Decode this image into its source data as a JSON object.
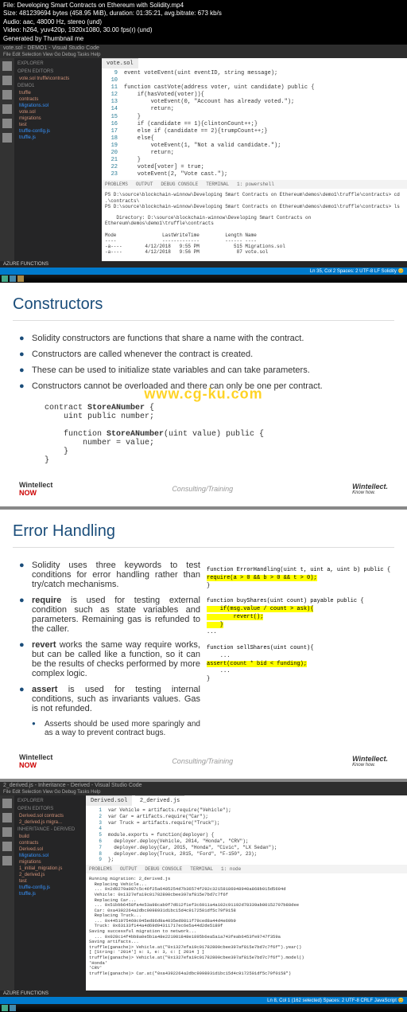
{
  "header": {
    "file": "File: Developing Smart Contracts on Ethereum with Solidity.mp4",
    "size": "Size: 481239694 bytes (458.95 MiB), duration: 01:35:21, avg.bitrate: 673 kb/s",
    "audio": "Audio: aac, 48000 Hz, stereo (und)",
    "video": "Video: h264, yuv420p, 1920x1080, 30.00 fps(r) (und)",
    "gen": "Generated by Thumbnail me"
  },
  "vscode1": {
    "title": "vote.sol - DEMO1 - Visual Studio Code",
    "menu": "File  Edit  Selection  View  Go  Debug  Tasks  Help",
    "explorer": "EXPLORER",
    "open_editors": "OPEN EDITORS",
    "open_file": "vote.sol truffle\\contracts",
    "project": "DEMO1",
    "tree": [
      "truffle",
      "contracts",
      "Migrations.sol",
      "vote.sol",
      "migrations",
      "test",
      "truffle-config.js",
      "truffle.js"
    ],
    "azure": "AZURE FUNCTIONS",
    "tab": "vote.sol",
    "code_lines": [
      {
        "n": "9",
        "t": "event voteEvent(uint eventID, string message);"
      },
      {
        "n": "10",
        "t": ""
      },
      {
        "n": "11",
        "t": "function castVote(address voter, uint candidate) public {"
      },
      {
        "n": "12",
        "t": "    if(hasVoted(voter)){"
      },
      {
        "n": "13",
        "t": "        voteEvent(0, \"Account has already voted.\");"
      },
      {
        "n": "14",
        "t": "        return;"
      },
      {
        "n": "15",
        "t": "    }"
      },
      {
        "n": "16",
        "t": "    if (candidate == 1){clintonCount++;}"
      },
      {
        "n": "17",
        "t": "    else if (candidate == 2){trumpCount++;}"
      },
      {
        "n": "18",
        "t": "    else{"
      },
      {
        "n": "19",
        "t": "        voteEvent(1, \"Not a valid candidate.\");"
      },
      {
        "n": "20",
        "t": "        return;"
      },
      {
        "n": "21",
        "t": "    }"
      },
      {
        "n": "22",
        "t": "    voted[voter] = true;"
      },
      {
        "n": "23",
        "t": "    voteEvent(2, \"Vote cast.\");"
      }
    ],
    "term_tabs": [
      "PROBLEMS",
      "OUTPUT",
      "DEBUG CONSOLE",
      "TERMINAL"
    ],
    "term_select": "1: powershell",
    "term_body": "PS D:\\source\\blockchain-winnow\\Developing Smart Contracts on Ethereum\\demos\\demo1\\truffle\\contracts> cd .\\contracts\\\nPS D:\\source\\blockchain-winnow\\Developing Smart Contracts on Ethereum\\demos\\demo1\\truffle\\contracts> ls\n\n    Directory: D:\\source\\blockchain-winnow\\Developing Smart Contracts on Ethereum\\demos\\demo1\\truffle\\contracts\n\nMode                LastWriteTime         Length Name\n----                -------------         ------ ----\n-a----        4/12/2018   9:55 PM            515 Migrations.sol\n-a----        4/12/2018   9:56 PM             87 vote.sol\n\nPS D:\\source\\blockchain-winnow\\Developing Smart Contracts on Ethereum\\demos\\demo1\\truffle\\contracts>",
    "status_right": "Ln 35, Col 2   Spaces: 2   UTF-8   LF   Solidity   😊"
  },
  "slide1": {
    "title": "Constructors",
    "bullets": [
      "Solidity constructors are functions that share a name with the contract.",
      "Constructors are called whenever the contract is created.",
      "These can be used to initialize state variables and can take parameters.",
      "Constructors cannot be overloaded and there can only be one per contract."
    ],
    "code": "contract StoreANumber {\n    uint public number;\n\n    function StoreANumber(uint value) public {\n        number = value;\n    }\n}",
    "footer_center": "Consulting/Training",
    "watermark": "www.cg-ku.com",
    "logo_now": "Wintellect NOW",
    "logo_win": "Wintellect.",
    "logo_win_sub": "Know how."
  },
  "slide2": {
    "title": "Error Handling",
    "bullets": [
      "Solidity uses three keywords to test conditions for error handling rather than try/catch mechanisms.",
      "require is used for testing external condition such as state variables and parameters. Remaining gas is refunded to the caller.",
      "revert works the same way require works, but can be called like a function, so it can be the results of checks performed by more complex logic.",
      "assert is used for testing internal conditions, such as invariants values. Gas is not refunded."
    ],
    "sub_bullet": "Asserts should be used more sparingly and as a way to prevent contract bugs.",
    "code_r1": "function ErrorHandling(uint t, uint a, uint b) public {",
    "code_r1_hl": "    require(a > 0 && b > 0 && t > 0);",
    "code_r1b": "}",
    "code_r2": "function buyShares(uint count) payable public {",
    "code_r2_hl": "    if(msg.value / count > ask){\n        revert();",
    "code_r2b": "    }\n    ...",
    "code_r3": "function sellShares(uint count){\n    ...",
    "code_r3_hl": "    assert(count * bid < funding);",
    "code_r3b": "    ...\n}",
    "footer_center": "Consulting/Training"
  },
  "vscode2": {
    "title": "2_derived.js - Inheritance - Derived - Visual Studio Code",
    "explorer": "EXPLORER",
    "open_editors": "OPEN EDITORS",
    "open_files": [
      "Derived.sol contracts",
      "2_derived.js migra..."
    ],
    "project": "INHERITANCE - DERIVED",
    "tree": [
      "build",
      "contracts",
      "Derived.sol",
      "Migrations.sol",
      "migrations",
      "1_initial_migration.js",
      "2_derived.js",
      "test",
      "truffle-config.js",
      "truffle.js"
    ],
    "azure": "AZURE FUNCTIONS",
    "tabs": [
      "Derived.sol",
      "2_derived.js"
    ],
    "code_lines": [
      {
        "n": "1",
        "t": "var Vehicle = artifacts.require(\"Vehicle\");"
      },
      {
        "n": "2",
        "t": "var Car = artifacts.require(\"Car\");"
      },
      {
        "n": "3",
        "t": "var Truck = artifacts.require(\"Truck\");"
      },
      {
        "n": "4",
        "t": ""
      },
      {
        "n": "5",
        "t": "module.exports = function(deployer) {"
      },
      {
        "n": "6",
        "t": "  deployer.deploy(Vehicle, 2014, \"Honda\", \"CRV\");"
      },
      {
        "n": "7",
        "t": "  deployer.deploy(Car, 2015, \"Honda\", \"Civic\", \"LX Sedan\");"
      },
      {
        "n": "8",
        "t": "  deployer.deploy(Truck, 2015, \"Ford\", \"F-150\", 23);"
      },
      {
        "n": "9",
        "t": "};"
      }
    ],
    "term_tabs": [
      "PROBLEMS",
      "OUTPUT",
      "DEBUG CONSOLE",
      "TERMINAL"
    ],
    "term_select": "1: node",
    "term_body": "Running migration: 2_derived.js\n  Replacing Vehicle...\n  ... 0x2d8279a087c5c46f25a6485254d7b36574f292c32158186048940a868b015d5694d\n  Vehicle: 0x1327efa19c01782800cbee397af815e7bd7c7f6f\n  Replacing Car...\n  ... 0x51bbb6458fa4e53a98cab9f7d612f1ef3c6911a4a102c91192d78339ab80152707b88dee\n  Car: 0xa4392264a2dbc9098931d1bc15d4c9172501df5c79f0158\n  Replacing Truck...\n  ... 0x4451975469c945ed86d9a4035ed9811f79ced8a44d4e69b9\n  Truck: 0x63133f144a4d69d94311717ec6e5a44d2de5189f\nSaving successful migration to network...\n  ... 0x028c14f4bb8a0e5b1a48e221981848e1895b6ea5a1a743feab6453fe9747f359a\nSaving artifacts...\ntruffle(ganache)> Vehicle.at(\"0x1327efa19c01782800cbee397af815e7bd7c7f6f\").year()\n[ [String: '2014'] s: 1, e: 3, c: [ 2014 ] ]\ntruffle(ganache)> Vehicle.at(\"0x1327efa19c01782800cbee397af815e7bd7c7f6f\").model()\n'Honda'\n'CRV'\ntruffle(ganache)> Car.at(\"0xa4392264a2dbc9098931d1bc15d4c9172501df5c79f0158\")",
    "status_right": "Ln 8, Col 1 (162 selected)   Spaces: 2   UTF-8   CRLF   JavaScript   😊"
  }
}
